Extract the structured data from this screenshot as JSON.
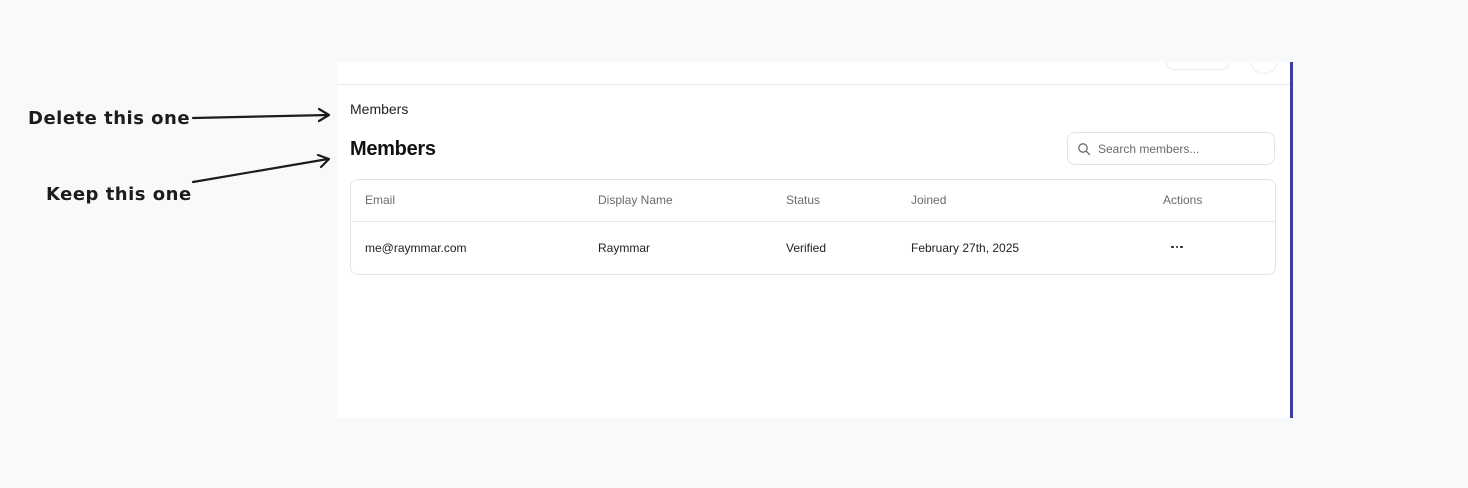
{
  "annotations": {
    "delete_label": "Delete this one",
    "keep_label": "Keep this one"
  },
  "breadcrumb": {
    "label": "Members"
  },
  "header": {
    "title": "Members"
  },
  "search": {
    "placeholder": "Search members...",
    "value": ""
  },
  "table": {
    "columns": [
      "Email",
      "Display Name",
      "Status",
      "Joined",
      "Actions"
    ],
    "rows": [
      {
        "email": "me@raymmar.com",
        "display_name": "Raymmar",
        "status": "Verified",
        "joined": "February 27th, 2025",
        "actions_icon": "more-horizontal-icon"
      }
    ]
  },
  "colors": {
    "accent_border": "#3b3f9e",
    "background": "#f8f9fb"
  }
}
